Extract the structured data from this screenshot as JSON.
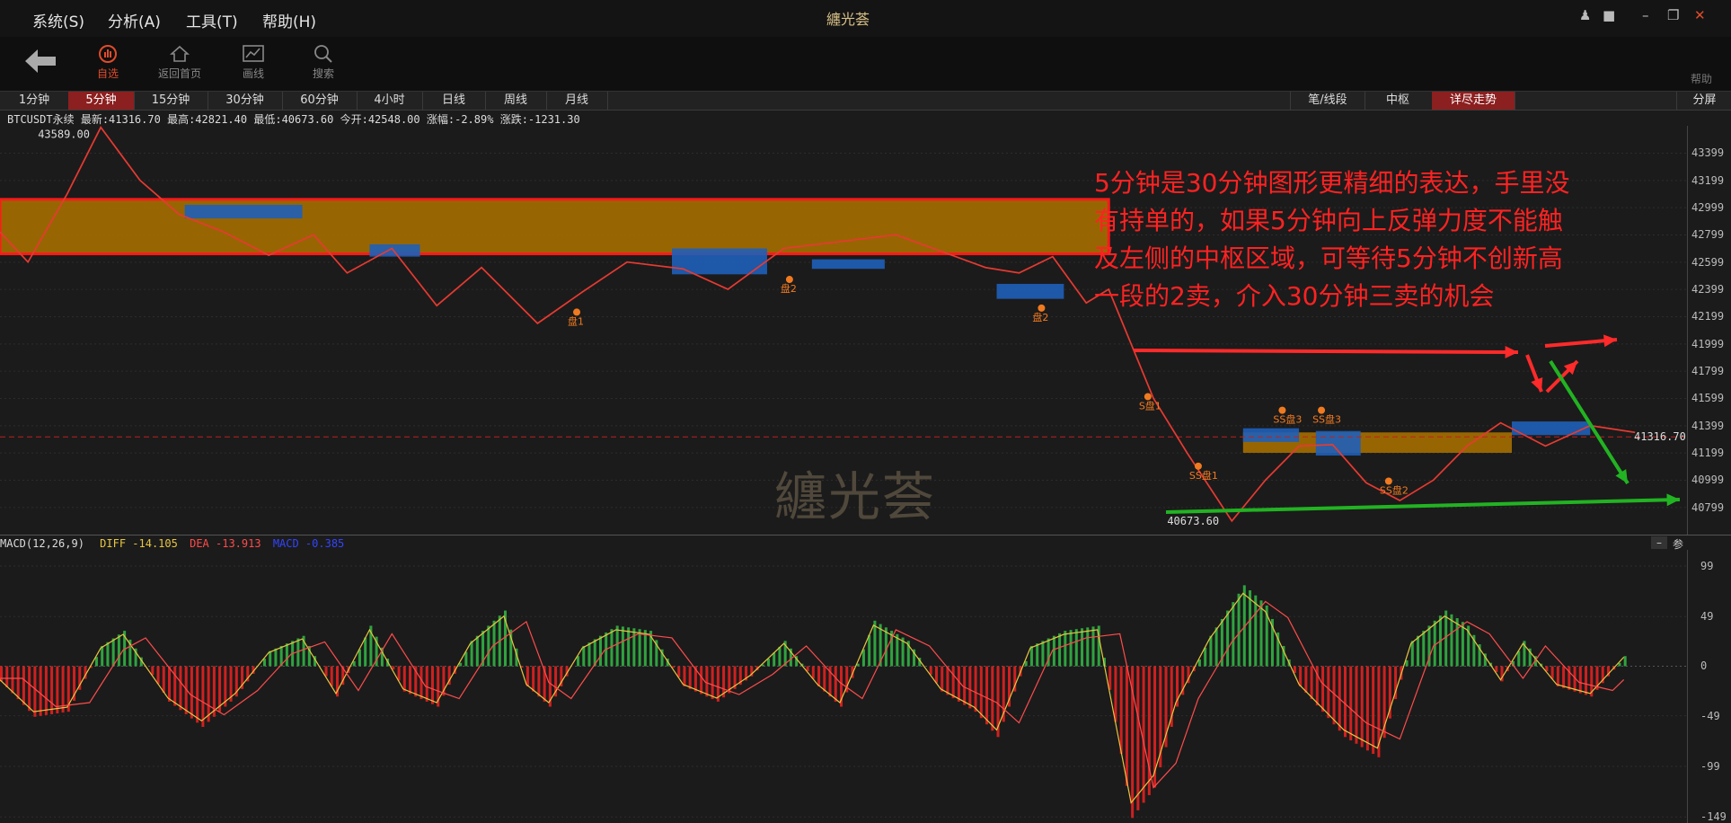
{
  "menu": {
    "items": [
      "系统(S)",
      "分析(A)",
      "工具(T)",
      "帮助(H)"
    ]
  },
  "app": {
    "logo_text": "纏光荟"
  },
  "toolbar": {
    "back_icon": "back-arrow-icon",
    "items": [
      {
        "label": "自选",
        "icon": "watchlist-icon",
        "active": true
      },
      {
        "label": "返回首页",
        "icon": "home-icon",
        "active": false
      },
      {
        "label": "画线",
        "icon": "draw-line-icon",
        "active": false
      },
      {
        "label": "搜索",
        "icon": "search-icon",
        "active": false
      }
    ],
    "help_label": "帮助"
  },
  "period_tabs": [
    "1分钟",
    "5分钟",
    "15分钟",
    "30分钟",
    "60分钟",
    "4小时",
    "日线",
    "周线",
    "月线"
  ],
  "active_period": "5分钟",
  "right_tabs": [
    "笔/线段",
    "中枢",
    "详尽走势"
  ],
  "active_right_tab": "详尽走势",
  "split_label": "分屏",
  "quote": {
    "symbol": "BTCUSDT永续",
    "latest": "最新:41316.70",
    "high": "最高:42821.40",
    "low": "最低:40673.60",
    "open": "今开:42548.00",
    "change_pct": "涨幅:-2.89%",
    "change": "涨跌:-1231.30"
  },
  "chart_data": {
    "type": "line",
    "price_axis_ticks": [
      "43399",
      "43199",
      "42999",
      "42799",
      "42599",
      "42399",
      "42199",
      "41999",
      "41799",
      "41599",
      "41399",
      "41199",
      "40999",
      "40799"
    ],
    "price_ylim": [
      40600,
      43600
    ],
    "current_price": "41316.70",
    "high_marker": "43589.00",
    "low_marker": "40673.60",
    "price_path": [
      [
        0,
        42820
      ],
      [
        5,
        42600
      ],
      [
        12,
        43100
      ],
      [
        18,
        43589
      ],
      [
        25,
        43200
      ],
      [
        32,
        42950
      ],
      [
        40,
        42820
      ],
      [
        48,
        42650
      ],
      [
        56,
        42800
      ],
      [
        62,
        42520
      ],
      [
        70,
        42700
      ],
      [
        78,
        42280
      ],
      [
        86,
        42560
      ],
      [
        96,
        42150
      ],
      [
        104,
        42380
      ],
      [
        112,
        42600
      ],
      [
        122,
        42550
      ],
      [
        130,
        42400
      ],
      [
        140,
        42700
      ],
      [
        150,
        42750
      ],
      [
        160,
        42800
      ],
      [
        170,
        42650
      ],
      [
        176,
        42560
      ],
      [
        182,
        42520
      ],
      [
        188,
        42640
      ],
      [
        194,
        42300
      ],
      [
        198,
        42400
      ],
      [
        206,
        41600
      ],
      [
        212,
        41200
      ],
      [
        220,
        40700
      ],
      [
        226,
        41000
      ],
      [
        232,
        41250
      ],
      [
        238,
        41260
      ],
      [
        244,
        40980
      ],
      [
        250,
        40850
      ],
      [
        256,
        41000
      ],
      [
        262,
        41250
      ],
      [
        268,
        41420
      ],
      [
        276,
        41250
      ],
      [
        284,
        41400
      ],
      [
        292,
        41350
      ]
    ],
    "zhongshu_boxes": [
      {
        "x0": 0,
        "x1": 198,
        "y0": 42660,
        "y1": 43060,
        "color": "#a56f00"
      },
      {
        "x0": 222,
        "x1": 270,
        "y0": 41200,
        "y1": 41350,
        "color": "#a56f00"
      }
    ],
    "blue_boxes": [
      {
        "x0": 33,
        "x1": 54,
        "y0": 42920,
        "y1": 43020
      },
      {
        "x0": 66,
        "x1": 75,
        "y0": 42640,
        "y1": 42730
      },
      {
        "x0": 120,
        "x1": 137,
        "y0": 42510,
        "y1": 42700
      },
      {
        "x0": 145,
        "x1": 158,
        "y0": 42550,
        "y1": 42620
      },
      {
        "x0": 178,
        "x1": 190,
        "y0": 42330,
        "y1": 42440
      },
      {
        "x0": 222,
        "x1": 232,
        "y0": 41280,
        "y1": 41380
      },
      {
        "x0": 235,
        "x1": 243,
        "y0": 41180,
        "y1": 41360
      },
      {
        "x0": 270,
        "x1": 284,
        "y0": 41330,
        "y1": 41430
      }
    ],
    "point_labels": [
      {
        "text": "盘1",
        "x": 103,
        "y": 42140
      },
      {
        "text": "盘2",
        "x": 141,
        "y": 42380
      },
      {
        "text": "盘2",
        "x": 186,
        "y": 42170
      },
      {
        "text": "S盘1",
        "x": 205,
        "y": 41520
      },
      {
        "text": "SS盘1",
        "x": 214,
        "y": 41010
      },
      {
        "text": "SS盘3",
        "x": 229,
        "y": 41420
      },
      {
        "text": "SS盘3",
        "x": 236,
        "y": 41420
      },
      {
        "text": "SS盘2",
        "x": 248,
        "y": 40900
      }
    ],
    "macd": {
      "label": "MACD(12,26,9)",
      "diff_text": "DIFF -14.105",
      "dea_text": "DEA -13.913",
      "macd_text": "MACD -0.385",
      "ticks": [
        "99",
        "49",
        "0",
        "-49",
        "-99",
        "-149"
      ],
      "ylim": [
        -155,
        115
      ],
      "hist": [
        [
          0,
          -15
        ],
        [
          6,
          -50
        ],
        [
          12,
          -45
        ],
        [
          18,
          20
        ],
        [
          22,
          35
        ],
        [
          30,
          -35
        ],
        [
          36,
          -60
        ],
        [
          42,
          -30
        ],
        [
          48,
          15
        ],
        [
          54,
          30
        ],
        [
          60,
          -30
        ],
        [
          66,
          40
        ],
        [
          72,
          -25
        ],
        [
          78,
          -40
        ],
        [
          84,
          25
        ],
        [
          90,
          55
        ],
        [
          94,
          -20
        ],
        [
          98,
          -40
        ],
        [
          104,
          20
        ],
        [
          110,
          40
        ],
        [
          116,
          35
        ],
        [
          122,
          -20
        ],
        [
          128,
          -35
        ],
        [
          134,
          -10
        ],
        [
          140,
          25
        ],
        [
          146,
          -20
        ],
        [
          150,
          -40
        ],
        [
          156,
          45
        ],
        [
          162,
          25
        ],
        [
          168,
          -25
        ],
        [
          174,
          -45
        ],
        [
          178,
          -70
        ],
        [
          184,
          20
        ],
        [
          190,
          35
        ],
        [
          196,
          40
        ],
        [
          202,
          -150
        ],
        [
          206,
          -120
        ],
        [
          210,
          -40
        ],
        [
          216,
          30
        ],
        [
          222,
          80
        ],
        [
          226,
          60
        ],
        [
          232,
          -20
        ],
        [
          240,
          -70
        ],
        [
          246,
          -90
        ],
        [
          252,
          25
        ],
        [
          258,
          55
        ],
        [
          262,
          40
        ],
        [
          268,
          -15
        ],
        [
          272,
          25
        ],
        [
          278,
          -20
        ],
        [
          284,
          -30
        ],
        [
          290,
          10
        ]
      ]
    }
  },
  "annotation": {
    "lines": [
      "5分钟是30分钟图形更精细的表达，手里没",
      "有持单的，如果5分钟向上反弹力度不能触",
      "及左侧的中枢区域，可等待5分钟不创新高",
      "一段的2卖，介入30分钟三卖的机会"
    ]
  },
  "watermark": "纏光荟",
  "colors": {
    "accent": "#e04b2b",
    "zhongshu": "#a56f00",
    "blue_box": "#1f5fb8",
    "bi_line": "#ff2a2a",
    "up_arrow": "#ff2a2a",
    "down_arrow": "#22b322"
  }
}
